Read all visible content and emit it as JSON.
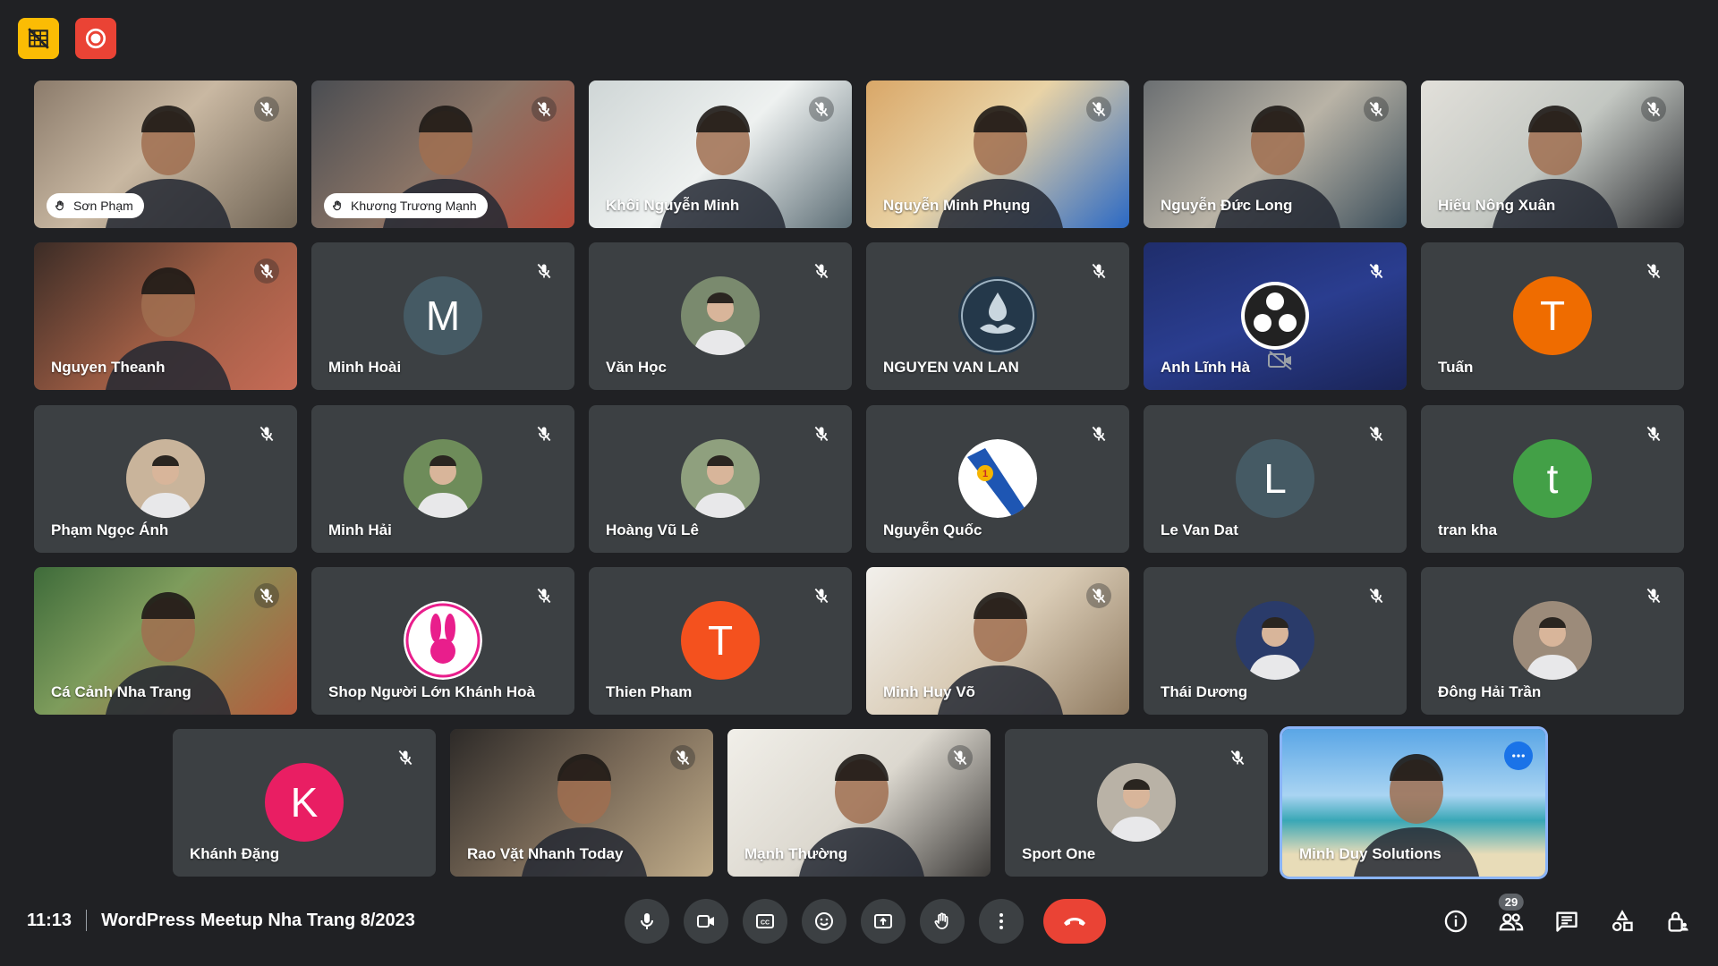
{
  "meeting": {
    "time": "11:13",
    "title": "WordPress Meetup Nha Trang 8/2023",
    "participant_count": "29"
  },
  "colors": {
    "background": "#202124",
    "tile": "#3c4043",
    "hangup": "#ea4335",
    "self_border": "#8ab4f8",
    "badge_yellow": "#fbbc04",
    "badge_red": "#ea4335"
  },
  "rows": [
    [
      {
        "name": "Sơn Phạm",
        "type": "video",
        "pill": true,
        "bg": "linear-gradient(135deg,#8b7b6b,#c9b8a2 45%,#6e6253)"
      },
      {
        "name": "Khương Trương Mạnh",
        "type": "video",
        "pill": true,
        "bg": "linear-gradient(135deg,#4a4d52,#8a7466 50%,#b44a3a)"
      },
      {
        "name": "Khôi Nguyễn Minh",
        "type": "video",
        "bg": "linear-gradient(135deg,#cfd6d6,#eef1f0 50%,#5c6d75)"
      },
      {
        "name": "Nguyễn Minh Phụng",
        "type": "video",
        "bg": "linear-gradient(135deg,#d9a768,#e9d3a6 45%,#2b69c4)"
      },
      {
        "name": "Nguyễn Đức Long",
        "type": "video",
        "bg": "linear-gradient(135deg,#6b6f72,#b9b3a6 50%,#3a4d5a)"
      },
      {
        "name": "Hiếu Nông Xuân",
        "type": "video",
        "bg": "linear-gradient(135deg,#e2e0da,#c3c7c2 50%,#2d2f33)"
      }
    ],
    [
      {
        "name": "Nguyen Theanh",
        "type": "video",
        "bg": "linear-gradient(135deg,#3b2c26,#9a5b43 50%,#c66b56)"
      },
      {
        "name": "Minh Hoài",
        "type": "letter",
        "letter": "M",
        "color": "#455a64"
      },
      {
        "name": "Văn Học",
        "type": "photo",
        "color": "#7a8a6e"
      },
      {
        "name": "NGUYEN VAN LAN",
        "type": "logo",
        "logo": "lan"
      },
      {
        "name": "Anh Lĩnh Hà",
        "type": "obs"
      },
      {
        "name": "Tuấn",
        "type": "letter",
        "letter": "T",
        "color": "#ef6c00"
      }
    ],
    [
      {
        "name": "Phạm Ngọc Ánh",
        "type": "photo",
        "color": "#c9b49b"
      },
      {
        "name": "Minh Hải",
        "type": "photo",
        "color": "#6e8c5a"
      },
      {
        "name": "Hoàng Vũ Lê",
        "type": "photo",
        "color": "#8fa07e"
      },
      {
        "name": "Nguyễn Quốc",
        "type": "logo",
        "logo": "cotruong"
      },
      {
        "name": "Le Van Dat",
        "type": "letter",
        "letter": "L",
        "color": "#455a64"
      },
      {
        "name": "tran kha",
        "type": "letter",
        "letter": "t",
        "color": "#43a047"
      }
    ],
    [
      {
        "name": "Cá Cảnh Nha Trang",
        "type": "video",
        "bg": "linear-gradient(135deg,#3e6b3a,#7e9c5c 40%,#b55a3c)"
      },
      {
        "name": "Shop Người Lớn Khánh Hoà",
        "type": "logo",
        "logo": "shop"
      },
      {
        "name": "Thien Pham",
        "type": "letter",
        "letter": "T",
        "color": "#f4511e"
      },
      {
        "name": "Minh Huy Võ",
        "type": "video",
        "bg": "linear-gradient(135deg,#f2f0ec,#d9cbb5 50%,#8f7a60)"
      },
      {
        "name": "Thái Dương",
        "type": "photo",
        "color": "#2a3b6a"
      },
      {
        "name": "Đông Hải Trần",
        "type": "photo",
        "color": "#9c8b7a"
      }
    ],
    [
      {
        "name": "Khánh Đặng",
        "type": "letter",
        "letter": "K",
        "color": "#e91e63"
      },
      {
        "name": "Rao Vặt Nhanh Today",
        "type": "video",
        "bg": "linear-gradient(135deg,#2d2a28,#7a6a58 50%,#c1ad8a)"
      },
      {
        "name": "Mạnh Thường",
        "type": "video",
        "bg": "linear-gradient(135deg,#f1efe9,#dcd8cf 50%,#3c3a38)"
      },
      {
        "name": "Sport One",
        "type": "photo",
        "color": "#b9b2a6"
      },
      {
        "name": "Minh Duy Solutions",
        "type": "video",
        "self": true,
        "bg": "linear-gradient(180deg,#5aa6e6 0%,#a9d4f2 45%,#39a7b6 62%,#e8dcb8 85%)"
      }
    ]
  ]
}
